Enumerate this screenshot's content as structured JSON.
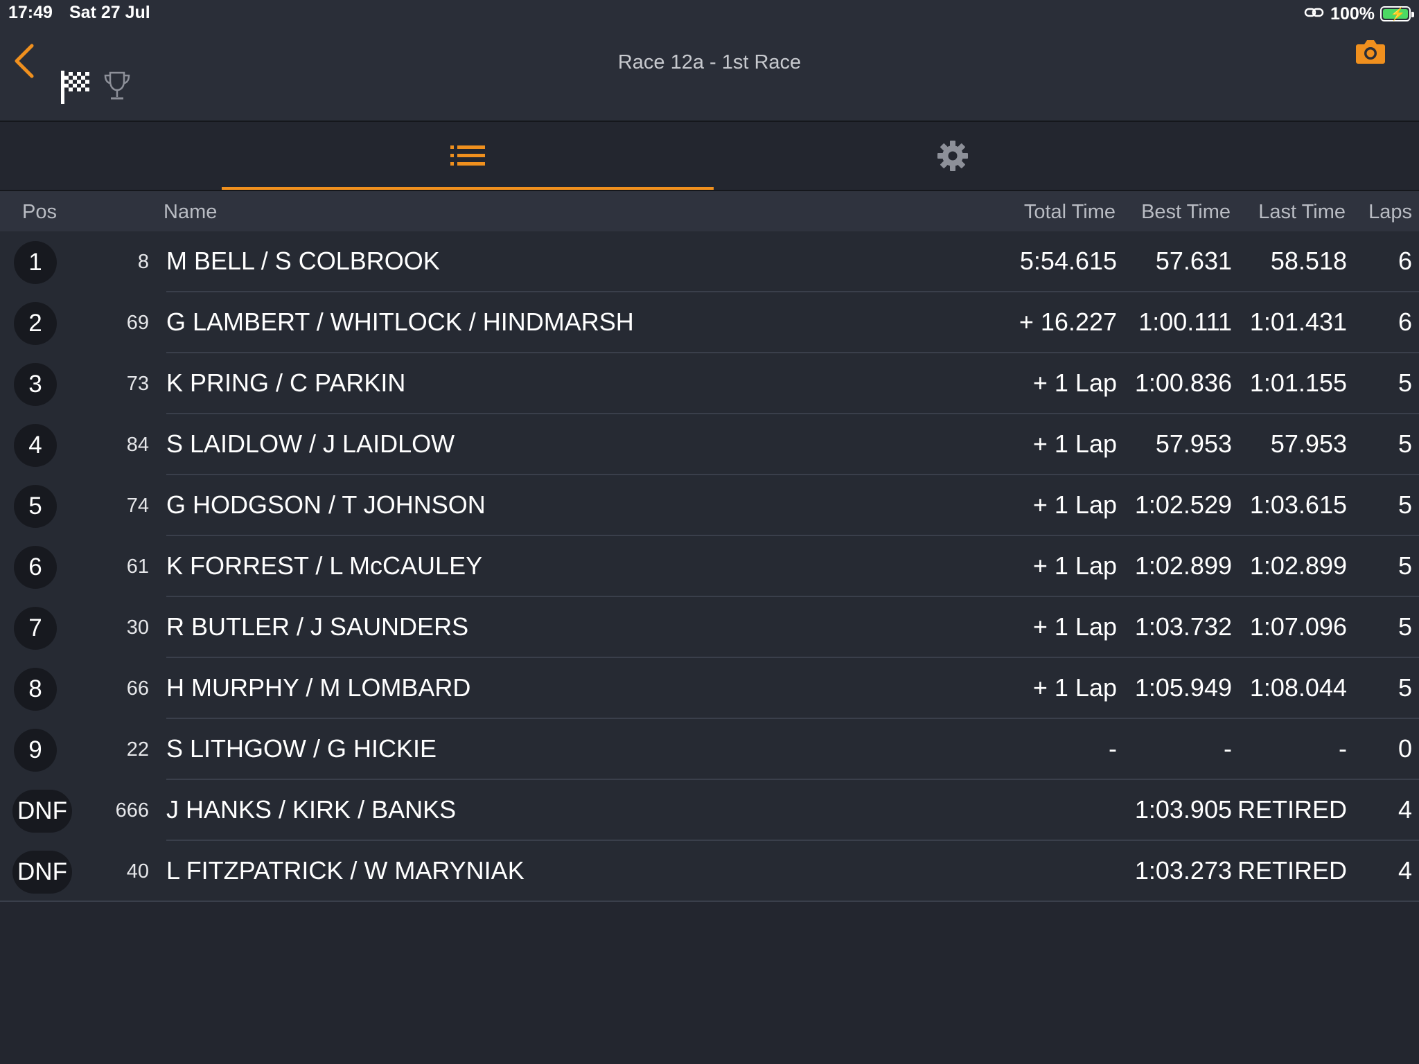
{
  "status_bar": {
    "time": "17:49",
    "date": "Sat 27 Jul",
    "battery": "100%"
  },
  "header": {
    "title": "Race 12a - 1st Race",
    "accent_color": "#f0901e"
  },
  "tabs": [
    {
      "icon": "list-icon",
      "active": true
    },
    {
      "icon": "gear-icon",
      "active": false
    }
  ],
  "table": {
    "headers": {
      "pos": "Pos",
      "name": "Name",
      "total": "Total Time",
      "best": "Best Time",
      "last": "Last Time",
      "laps": "Laps"
    },
    "rows": [
      {
        "pos": "1",
        "no": "8",
        "name": "M BELL / S COLBROOK",
        "total": "5:54.615",
        "best": "57.631",
        "last": "58.518",
        "laps": "6"
      },
      {
        "pos": "2",
        "no": "69",
        "name": "G LAMBERT / WHITLOCK / HINDMARSH",
        "total": "+ 16.227",
        "best": "1:00.111",
        "last": "1:01.431",
        "laps": "6"
      },
      {
        "pos": "3",
        "no": "73",
        "name": "K PRING / C PARKIN",
        "total": "+ 1 Lap",
        "best": "1:00.836",
        "last": "1:01.155",
        "laps": "5"
      },
      {
        "pos": "4",
        "no": "84",
        "name": "S LAIDLOW / J LAIDLOW",
        "total": "+ 1 Lap",
        "best": "57.953",
        "last": "57.953",
        "laps": "5"
      },
      {
        "pos": "5",
        "no": "74",
        "name": "G HODGSON / T JOHNSON",
        "total": "+ 1 Lap",
        "best": "1:02.529",
        "last": "1:03.615",
        "laps": "5"
      },
      {
        "pos": "6",
        "no": "61",
        "name": "K FORREST / L McCAULEY",
        "total": "+ 1 Lap",
        "best": "1:02.899",
        "last": "1:02.899",
        "laps": "5"
      },
      {
        "pos": "7",
        "no": "30",
        "name": "R BUTLER / J SAUNDERS",
        "total": "+ 1 Lap",
        "best": "1:03.732",
        "last": "1:07.096",
        "laps": "5"
      },
      {
        "pos": "8",
        "no": "66",
        "name": "H MURPHY / M LOMBARD",
        "total": "+ 1 Lap",
        "best": "1:05.949",
        "last": "1:08.044",
        "laps": "5"
      },
      {
        "pos": "9",
        "no": "22",
        "name": "S LITHGOW / G HICKIE",
        "total": "-",
        "best": "-",
        "last": "-",
        "laps": "0"
      },
      {
        "pos": "DNF",
        "no": "666",
        "name": "J HANKS / KIRK / BANKS",
        "total": "",
        "best": "1:03.905",
        "last": "RETIRED",
        "laps": "4"
      },
      {
        "pos": "DNF",
        "no": "40",
        "name": "L FITZPATRICK / W MARYNIAK",
        "total": "",
        "best": "1:03.273",
        "last": "RETIRED",
        "laps": "4"
      }
    ]
  }
}
